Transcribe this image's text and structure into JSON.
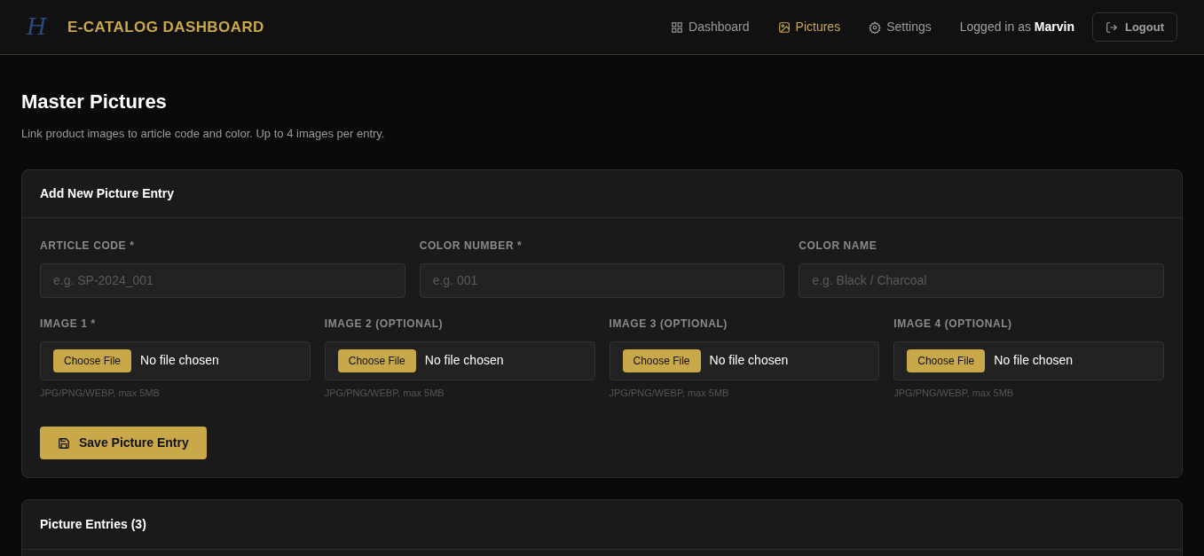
{
  "header": {
    "logo": "H",
    "title": "E-CATALOG DASHBOARD",
    "nav": [
      {
        "label": "Dashboard",
        "selected": false
      },
      {
        "label": "Pictures",
        "selected": true
      },
      {
        "label": "Settings",
        "selected": false
      }
    ],
    "user": "Logged in as **Marvin**",
    "logout": "Logout"
  },
  "page": {
    "title": "Master Pictures",
    "subtitle": "Link product images to article code and color. Up to 4 images per entry."
  },
  "form": {
    "title": "Add New Picture Entry",
    "fields": [
      {
        "label": "ARTICLE CODE *",
        "placeholder": "e.g. SP-2024_001"
      },
      {
        "label": "COLOR NUMBER *",
        "placeholder": "e.g. 001"
      },
      {
        "label": "COLOR NAME",
        "placeholder": "e.g. Black / Charcoal"
      }
    ],
    "images": [
      {
        "label": "IMAGE 1 *",
        "button": "Choose File",
        "status": "No file chosen",
        "hint": "JPG/PNG/WEBP, max 5MB"
      },
      {
        "label": "IMAGE 2 (OPTIONAL)",
        "button": "Choose File",
        "status": "No file chosen",
        "hint": "JPG/PNG/WEBP, max 5MB"
      },
      {
        "label": "IMAGE 3 (OPTIONAL)",
        "button": "Choose File",
        "status": "No file chosen",
        "hint": "JPG/PNG/WEBP, max 5MB"
      },
      {
        "label": "IMAGE 4 (OPTIONAL)",
        "button": "Choose File",
        "status": "No file chosen",
        "hint": "JPG/PNG/WEBP, max 5MB"
      }
    ],
    "save": "Save Picture Entry"
  },
  "entries": {
    "title": "Picture Entries (3)"
  }
}
